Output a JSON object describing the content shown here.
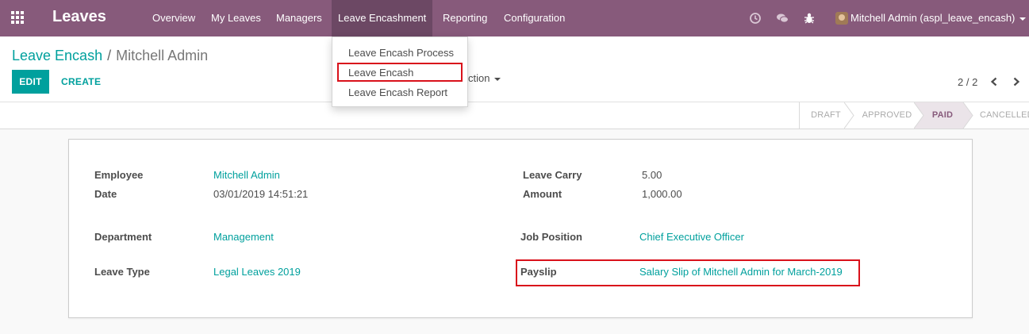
{
  "navbar": {
    "brand": "Leaves",
    "menu": [
      {
        "label": "Overview"
      },
      {
        "label": "My Leaves"
      },
      {
        "label": "Managers"
      },
      {
        "label": "Leave Encashment"
      },
      {
        "label": "Reporting"
      },
      {
        "label": "Configuration"
      }
    ],
    "user_name": "Mitchell Admin (aspl_leave_encash)"
  },
  "dropdown": {
    "items": [
      {
        "label": "Leave Encash Process"
      },
      {
        "label": "Leave Encash"
      },
      {
        "label": "Leave Encash Report"
      }
    ]
  },
  "breadcrumb": {
    "parent": "Leave Encash",
    "separator": "/",
    "current": "Mitchell Admin"
  },
  "buttons": {
    "edit": "EDIT",
    "create": "CREATE",
    "action": "ction"
  },
  "pager": {
    "value": "2 / 2"
  },
  "statusbar": {
    "stages": [
      "DRAFT",
      "APPROVED",
      "PAID",
      "CANCELLED"
    ],
    "active": "PAID"
  },
  "form": {
    "employee_label": "Employee",
    "employee": "Mitchell Admin",
    "date_label": "Date",
    "date": "03/01/2019 14:51:21",
    "leave_carry_label": "Leave Carry",
    "leave_carry": "5.00",
    "amount_label": "Amount",
    "amount": "1,000.00",
    "department_label": "Department",
    "department": "Management",
    "job_position_label": "Job Position",
    "job_position": "Chief Executive Officer",
    "leave_type_label": "Leave Type",
    "leave_type": "Legal Leaves 2019",
    "payslip_label": "Payslip",
    "payslip": "Salary Slip of Mitchell Admin for March-2019"
  },
  "colors": {
    "navbar": "#875a7b",
    "navbar_active": "#6c4864",
    "link": "#00a09d",
    "primary_button": "#00a09d",
    "highlight_box": "#d9111b",
    "status_active_bg": "#ebe4e9"
  }
}
